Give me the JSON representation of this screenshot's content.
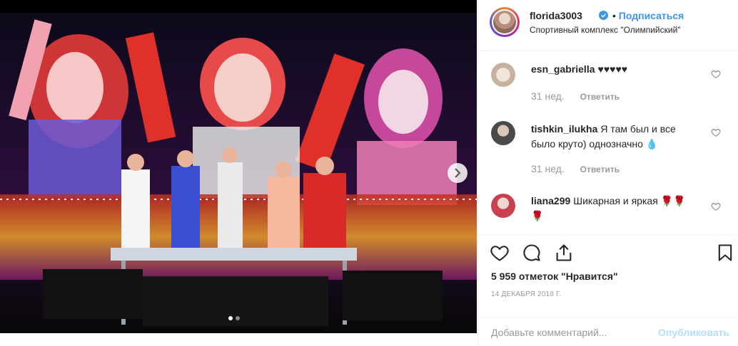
{
  "post": {
    "username": "florida3003",
    "follow_label": "Подписаться",
    "location": "Спортивный комплекс \"Олимпийский\"",
    "likes": "5 959 отметок \"Нравится\"",
    "date": "14 ДЕКАБРЯ 2018 Г.",
    "photo_index": 1,
    "photo_count": 2
  },
  "comments": [
    {
      "user": "esn_gabriella",
      "text": "♥♥♥♥♥",
      "age": "31 нед.",
      "reply": "Ответить"
    },
    {
      "user": "tishkin_ilukha",
      "text": "Я там был и все было круто) однозначно 💧",
      "age": "31 нед.",
      "reply": "Ответить"
    },
    {
      "user": "liana299",
      "text": "Шикарная и яркая 🌹🌹🌹",
      "age": "",
      "reply": ""
    }
  ],
  "add_comment": {
    "placeholder": "Добавьте комментарий...",
    "publish_label": "Опубликовать"
  },
  "icons": [
    "verified-badge-icon",
    "chevron-right-icon",
    "heart-icon",
    "comment-icon",
    "share-icon",
    "bookmark-icon"
  ],
  "colors": {
    "accent": "#3897f0",
    "text": "#262626",
    "muted": "#999999",
    "publish_disabled": "#b2dffc"
  }
}
